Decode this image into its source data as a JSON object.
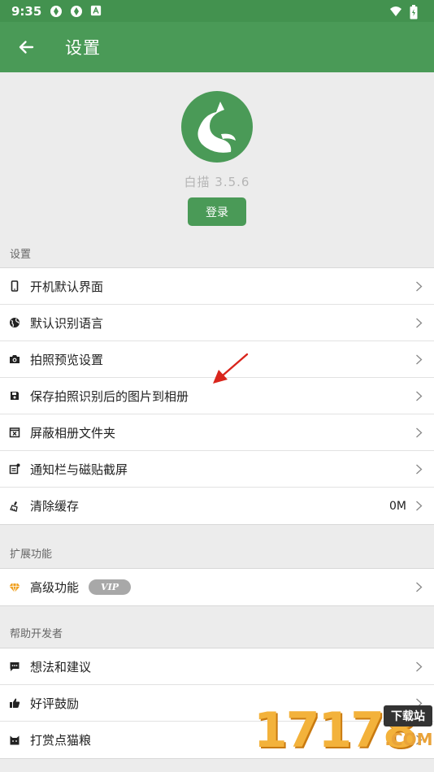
{
  "status_bar": {
    "time": "9:35"
  },
  "app_bar": {
    "title": "设置"
  },
  "header": {
    "app_name": "白描  3.5.6",
    "login_label": "登录"
  },
  "sections": {
    "settings": {
      "title": "设置",
      "items": [
        {
          "label": "开机默认界面"
        },
        {
          "label": "默认识别语言"
        },
        {
          "label": "拍照预览设置"
        },
        {
          "label": "保存拍照识别后的图片到相册"
        },
        {
          "label": "屏蔽相册文件夹"
        },
        {
          "label": "通知栏与磁贴截屏"
        },
        {
          "label": "清除缓存",
          "value": "0M"
        }
      ]
    },
    "extensions": {
      "title": "扩展功能",
      "items": [
        {
          "label": "高级功能",
          "badge": "VIP"
        }
      ]
    },
    "help": {
      "title": "帮助开发者",
      "items": [
        {
          "label": "想法和建议"
        },
        {
          "label": "好评鼓励"
        },
        {
          "label": "打赏点猫粮"
        }
      ]
    }
  },
  "watermark": {
    "number": "17178",
    "badge": "下载站",
    "domain": ".COM"
  },
  "colors": {
    "primary": "#4a9a57",
    "status_bar": "#43924f",
    "arrow": "#d9251c",
    "vip_gem": "#f0a020"
  }
}
